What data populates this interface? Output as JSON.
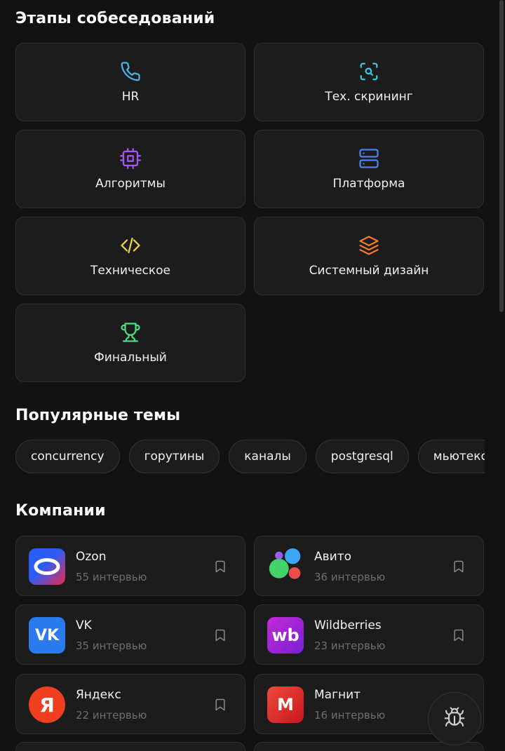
{
  "sections": {
    "stages_title": "Этапы собеседований",
    "topics_title": "Популярные темы",
    "companies_title": "Компании"
  },
  "stages": [
    {
      "label": "HR",
      "icon": "phone-icon",
      "color": "#4fb0e6"
    },
    {
      "label": "Тех. скрининг",
      "icon": "scan-search-icon",
      "color": "#3ec7d6"
    },
    {
      "label": "Алгоритмы",
      "icon": "cpu-icon",
      "color": "#a855f7"
    },
    {
      "label": "Платформа",
      "icon": "server-icon",
      "color": "#4f7ff0"
    },
    {
      "label": "Техническое",
      "icon": "code-icon",
      "color": "#f5d547"
    },
    {
      "label": "Системный дизайн",
      "icon": "layers-icon",
      "color": "#f07a2a"
    },
    {
      "label": "Финальный",
      "icon": "trophy-icon",
      "color": "#4ade80"
    }
  ],
  "topics": [
    "concurrency",
    "горутины",
    "каналы",
    "postgresql",
    "мьютексы"
  ],
  "companies": [
    {
      "name": "Ozon",
      "count": "55 интервью",
      "logo": "ozon-logo"
    },
    {
      "name": "Авито",
      "count": "36 интервью",
      "logo": "avito-logo"
    },
    {
      "name": "VK",
      "count": "35 интервью",
      "logo": "vk-logo"
    },
    {
      "name": "Wildberries",
      "count": "23 интервью",
      "logo": "wildberries-logo"
    },
    {
      "name": "Яндекс",
      "count": "22 интервью",
      "logo": "yandex-logo"
    },
    {
      "name": "Магнит",
      "count": "16 интервью",
      "logo": "magnit-logo"
    }
  ],
  "logo_text": {
    "vk": "VK",
    "wildberries": "wb",
    "yandex": "Я",
    "magnit": "М"
  },
  "fab": {
    "icon": "bug-icon"
  }
}
